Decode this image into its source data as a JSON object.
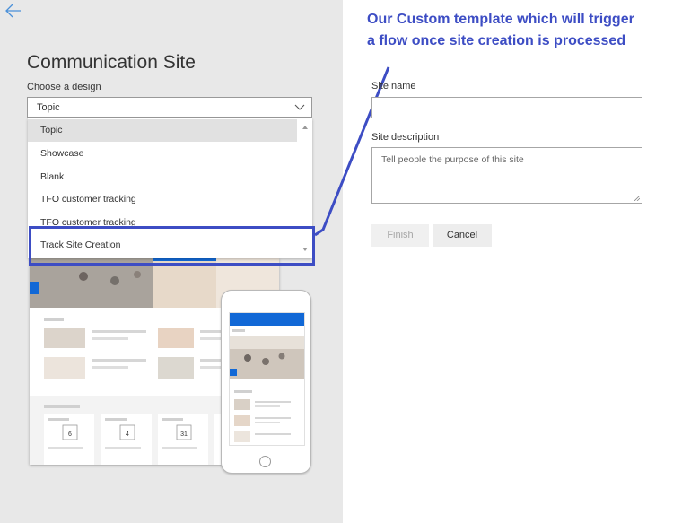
{
  "page": {
    "title": "Communication Site",
    "choose_label": "Choose a design",
    "selected_design": "Topic"
  },
  "dropdown": {
    "items": [
      {
        "label": "Topic",
        "selected": true
      },
      {
        "label": "Showcase",
        "selected": false
      },
      {
        "label": "Blank",
        "selected": false
      },
      {
        "label": "TFO customer tracking",
        "selected": false
      },
      {
        "label": "TFO customer tracking",
        "selected": false
      },
      {
        "label": "Track Site Creation",
        "selected": false
      }
    ]
  },
  "annotation": {
    "text": "Our Custom template which will trigger a flow once site creation is processed",
    "color": "#3d4dc4"
  },
  "form": {
    "site_name_label": "Site name",
    "site_name_value": "",
    "site_description_label": "Site description",
    "site_description_placeholder": "Tell people the purpose of this site",
    "finish_label": "Finish",
    "cancel_label": "Cancel"
  },
  "preview": {
    "calendar_days": [
      "6",
      "4",
      "31"
    ]
  },
  "colors": {
    "accent": "#1168d6",
    "annotation": "#3d4dc4",
    "panel_bg": "#e8e8e8"
  }
}
